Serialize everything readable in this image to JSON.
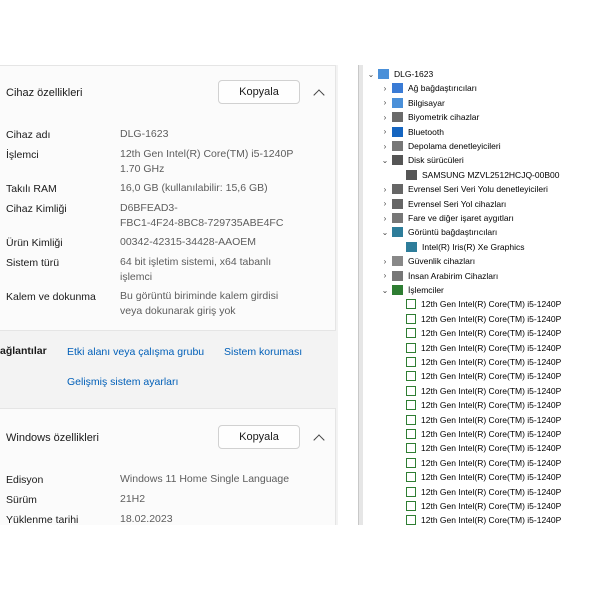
{
  "device_card": {
    "title": "Cihaz özellikleri",
    "copy_label": "Kopyala",
    "rows": [
      {
        "label": "Cihaz adı",
        "value": "DLG-1623"
      },
      {
        "label": "İşlemci",
        "value": "12th Gen Intel(R) Core(TM) i5-1240P",
        "value2": "1.70 GHz"
      },
      {
        "label": "Takılı RAM",
        "value": "16,0 GB (kullanılabilir: 15,6 GB)"
      },
      {
        "label": "Cihaz Kimliği",
        "value": "D6BFEAD3-",
        "value2": "FBC1-4F24-8BC8-729735ABE4FC"
      },
      {
        "label": "Ürün Kimliği",
        "value": "00342-42315-34428-AAOEM"
      },
      {
        "label": "Sistem türü",
        "value": "64 bit işletim sistemi, x64 tabanlı",
        "value2": "işlemci"
      },
      {
        "label": "Kalem ve dokunma",
        "value": "Bu görüntü biriminde kalem girdisi",
        "value2": "veya dokunarak giriş yok"
      }
    ]
  },
  "related": {
    "label": "ağlantılar",
    "links": [
      "Etki alanı veya çalışma grubu",
      "Sistem koruması",
      "Gelişmiş sistem ayarları"
    ]
  },
  "windows_card": {
    "title": "Windows özellikleri",
    "copy_label": "Kopyala",
    "rows": [
      {
        "label": "Edisyon",
        "value": "Windows 11 Home Single Language"
      },
      {
        "label": "Sürüm",
        "value": "21H2"
      },
      {
        "label": "Yüklenme tarihi",
        "value": "18.02.2023"
      }
    ]
  },
  "device_manager": {
    "root": "DLG-1623",
    "categories": [
      {
        "label": "Ağ bağdaştırıcıları",
        "icon": "network-adapter-icon"
      },
      {
        "label": "Bilgisayar",
        "icon": "computer-icon"
      },
      {
        "label": "Biyometrik cihazlar",
        "icon": "biometric-icon"
      },
      {
        "label": "Bluetooth",
        "icon": "bluetooth-icon"
      },
      {
        "label": "Depolama denetleyicileri",
        "icon": "storage-controller-icon"
      },
      {
        "label": "Disk sürücüleri",
        "icon": "disk-drive-icon",
        "expanded": true,
        "children": [
          "SAMSUNG MZVL2512HCJQ-00B00"
        ]
      },
      {
        "label": "Evrensel Seri Veri Yolu denetleyicileri",
        "icon": "usb-controller-icon"
      },
      {
        "label": "Evrensel Seri Yol cihazları",
        "icon": "usb-device-icon"
      },
      {
        "label": "Fare ve diğer işaret aygıtları",
        "icon": "mouse-icon"
      },
      {
        "label": "Görüntü bağdaştırıcıları",
        "icon": "display-adapter-icon",
        "expanded": true,
        "children": [
          "Intel(R) Iris(R) Xe Graphics"
        ]
      },
      {
        "label": "Güvenlik cihazları",
        "icon": "security-device-icon"
      },
      {
        "label": "İnsan Arabirim Cihazları",
        "icon": "hid-icon"
      },
      {
        "label": "İşlemciler",
        "icon": "processor-icon",
        "expanded": true,
        "children": [
          "12th Gen Intel(R) Core(TM) i5-1240P",
          "12th Gen Intel(R) Core(TM) i5-1240P",
          "12th Gen Intel(R) Core(TM) i5-1240P",
          "12th Gen Intel(R) Core(TM) i5-1240P",
          "12th Gen Intel(R) Core(TM) i5-1240P",
          "12th Gen Intel(R) Core(TM) i5-1240P",
          "12th Gen Intel(R) Core(TM) i5-1240P",
          "12th Gen Intel(R) Core(TM) i5-1240P",
          "12th Gen Intel(R) Core(TM) i5-1240P",
          "12th Gen Intel(R) Core(TM) i5-1240P",
          "12th Gen Intel(R) Core(TM) i5-1240P",
          "12th Gen Intel(R) Core(TM) i5-1240P",
          "12th Gen Intel(R) Core(TM) i5-1240P",
          "12th Gen Intel(R) Core(TM) i5-1240P",
          "12th Gen Intel(R) Core(TM) i5-1240P",
          "12th Gen Intel(R) Core(TM) i5-1240P"
        ]
      }
    ]
  }
}
